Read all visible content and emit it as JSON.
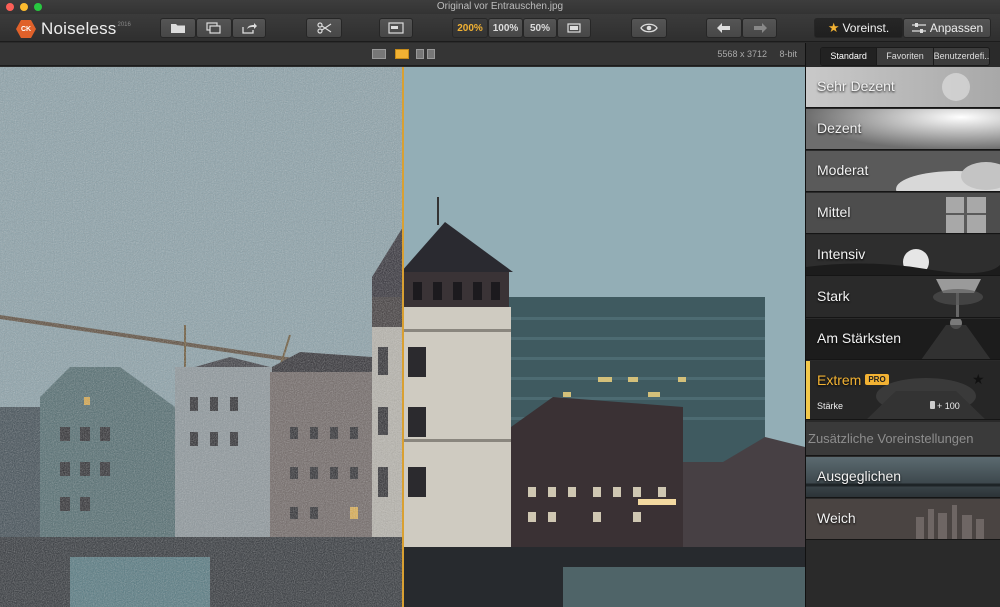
{
  "window": {
    "title": "Original vor Entrauschen.jpg"
  },
  "app": {
    "logo_text": "CK",
    "name": "Noiseless",
    "year": "2016"
  },
  "toolbar": {
    "zoom_options": [
      "200%",
      "100%",
      "50%"
    ],
    "zoom_active": "200%",
    "preset_button_label": "Voreinst.",
    "adjust_button_label": "Anpassen"
  },
  "image_info": {
    "dimensions": "5568 x 3712",
    "bit_depth": "8-bit"
  },
  "panel": {
    "tabs": [
      "Standard",
      "Favoriten",
      "Benutzerdefi..."
    ],
    "active_tab": "Standard",
    "presets": [
      {
        "label": "Sehr Dezent"
      },
      {
        "label": "Dezent"
      },
      {
        "label": "Moderat"
      },
      {
        "label": "Mittel"
      },
      {
        "label": "Intensiv"
      },
      {
        "label": "Stark"
      },
      {
        "label": "Am Stärksten"
      },
      {
        "label": "Extrem",
        "badge": "PRO",
        "selected": true,
        "strength_label": "Stärke",
        "strength_value": "+ 100"
      }
    ],
    "extra_section_title": "Zusätzliche Voreinstellungen",
    "extra_presets": [
      {
        "label": "Ausgeglichen"
      },
      {
        "label": "Weich"
      }
    ]
  },
  "colors": {
    "accent": "#f2b233",
    "divider": "#d9a032",
    "brand": "#e0612a"
  }
}
